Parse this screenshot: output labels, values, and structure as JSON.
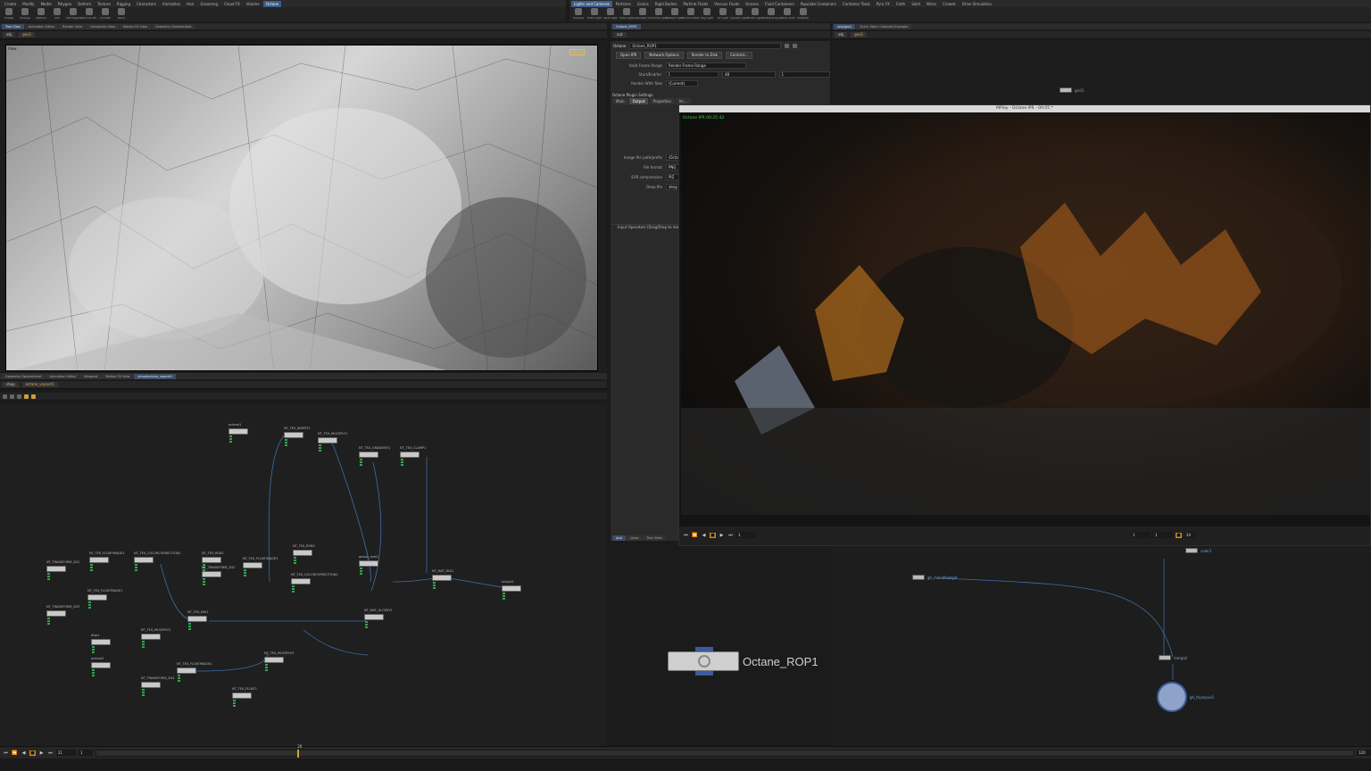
{
  "shelf": {
    "left_tabs": [
      "Create",
      "Modify",
      "Model",
      "Polygon",
      "Deform",
      "Texture",
      "Rigging",
      "Characters",
      "Animation",
      "Hair",
      "Grooming",
      "Cloud FX",
      "Volume",
      "Octane"
    ],
    "left_active": "Octane",
    "left_tools": [
      "Create",
      "Change",
      "Options",
      "Info",
      "Add Object",
      "Remove Ob..",
      "Cook2D",
      "About"
    ],
    "right_tabs": [
      "Lights and Cameras",
      "Particles",
      "Grains",
      "Rigid Bodies",
      "Particle Fluids",
      "Viscous Fluids",
      "Oceans",
      "Fluid Containers",
      "Populate Containers",
      "Container Tools",
      "Pyro FX",
      "Cloth",
      "Solid",
      "Wires",
      "Crowds",
      "Drive Simulation"
    ],
    "right_active": "Lights and Cameras",
    "right_tools": [
      "Camera",
      "Point Light",
      "Spot Light",
      "Area Light",
      "Geometry L..",
      "Volume Light",
      "Distant Light",
      "Environment",
      "Sky Light",
      "GI Light",
      "Caustic Light",
      "Portal Light",
      "Ambient Lig..",
      "Stereo Cam",
      "Switcher"
    ]
  },
  "viewport_pane": {
    "tabs": [
      "Tree View",
      "Animation Editor",
      "Render View",
      "Composite View",
      "Motion FX View",
      "Geometry Spreadsheet"
    ],
    "active": "Tree View",
    "path": [
      "obj",
      "geo2"
    ],
    "label": "View",
    "hud": "Persp"
  },
  "network_pane": {
    "tabs": [
      "Geometry Spreadsheet",
      "Animation Editor",
      "Viewport",
      "Motion FX View",
      "/shop/octane_vopnet1"
    ],
    "active": "/shop/octane_vopnet1",
    "path": [
      "shop",
      "octane_vopnet1"
    ],
    "nodes": [
      {
        "label": "octane1"
      },
      {
        "label": "NT_TEX_INVERT1"
      },
      {
        "label": "NT_TEX_MULTIPLY1"
      },
      {
        "label": "NT_TEX_GRADIENT1"
      },
      {
        "label": "NT_TEX_CLAMP1"
      },
      {
        "label": "NT_TEX_FLOATIMAGE2"
      },
      {
        "label": "NT_TEX_COLORCORRECTION1"
      },
      {
        "label": "NT_TRANSFORM_2D1"
      },
      {
        "label": "NT_TEX_RGB1"
      },
      {
        "label": "NT_TRANSFORM_2D2"
      },
      {
        "label": "NT_TEX_FLOATIMAGE3"
      },
      {
        "label": "NT_TEX_RGB2"
      },
      {
        "label": "NT_TEX_COLORCORRECTION2"
      },
      {
        "label": "glossy_mat1"
      },
      {
        "label": "NT_MAT_MIX1"
      },
      {
        "label": "NT_TEX_FLOATIMAGE1"
      },
      {
        "label": "NT_TRANSFORM_2D3"
      },
      {
        "label": "NT_TEX_MIX1"
      },
      {
        "label": "NT_TEX_MULTIPLY2"
      },
      {
        "label": "NT_MAT_GLOSSY1"
      },
      {
        "label": "disp1"
      },
      {
        "label": "octane2"
      },
      {
        "label": "NT_TEX_FLOATIMAGE4"
      },
      {
        "label": "NT_TRANSFORM_2D4"
      },
      {
        "label": "NT_TEX_MULTIPLY3"
      },
      {
        "label": "NT_TEX_FLOAT1"
      },
      {
        "label": "output1"
      }
    ]
  },
  "params": {
    "tabs": [
      "Octane_ROP1"
    ],
    "path": [
      "out"
    ],
    "node_type": "Octane",
    "node_name": "Octane_ROP1",
    "buttons": [
      "Open IPR",
      "Network Options",
      "Render to Disk",
      "Controls..."
    ],
    "valid_frame_range_label": "Valid Frame Range",
    "valid_frame_range": "Render Frame Range",
    "start_end_label": "Start/End/Inc",
    "start": "1",
    "end": "48",
    "inc": "1",
    "render_with_take_label": "Render With Take",
    "render_with_take": "(Current)",
    "section": "Octane Plugin Settings",
    "subtabs": [
      "Main",
      "Output",
      "Properties",
      "Im..."
    ],
    "active_subtab": "Output",
    "rows": [
      {
        "label": "Image file path/prefix",
        "value": "/Octa..."
      },
      {
        "label": "File format",
        "value": "PNG"
      },
      {
        "label": "EXR compression",
        "value": "PIZ"
      },
      {
        "label": "Deep file",
        "value": "deep"
      }
    ],
    "input_ops": "Input Operators (Drag/Drop to reorder)",
    "lower_tabs": [
      "/out",
      "/shop",
      "Tree View"
    ],
    "lower_active": "/out"
  },
  "mplay": {
    "title": "MPlay - Octane IPR - 00:05 *",
    "overlay": "Octane IPR 00:25.42",
    "frame": "1",
    "range_start": "1",
    "range_end": "1",
    "fps": "24"
  },
  "obj_net": {
    "tabs": [
      "/obj/geo2",
      "Quick Start: Calendar Example"
    ],
    "active": "/obj/geo2",
    "path": [
      "obj",
      "geo2"
    ],
    "nodes": [
      {
        "label": "grid1"
      },
      {
        "label": "color1"
      },
      {
        "label": "gh_makePointy8"
      },
      {
        "label": "merge2"
      },
      {
        "label": "gh_tripolyvx1"
      }
    ]
  },
  "rop": {
    "label": "Octane_ROP1"
  },
  "timeline": {
    "frame": "21",
    "start": "1",
    "end": "120",
    "marker": "20"
  },
  "colors": {
    "accent": "#3c5c8a",
    "play_active": "#c98b1f",
    "ports": "#2fa84a",
    "obj_label": "#7aa7d8",
    "overlay": "#3ccf4e"
  }
}
